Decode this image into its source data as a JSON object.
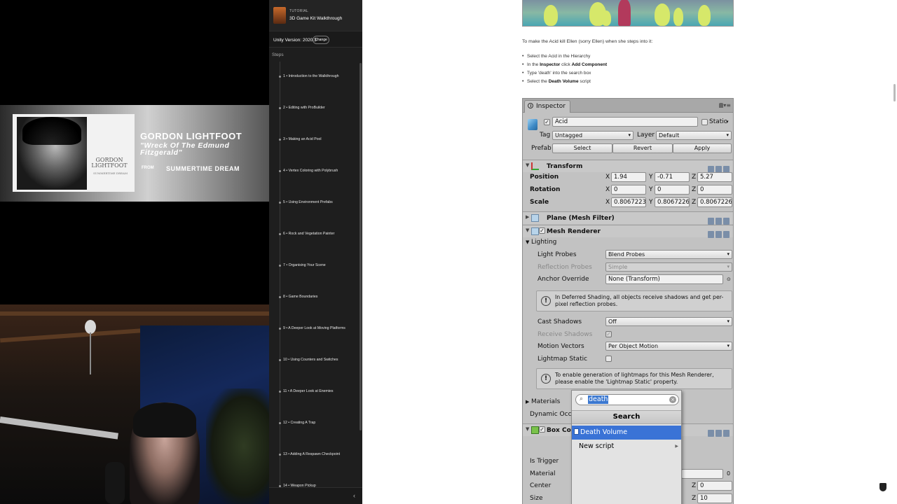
{
  "overlay": {
    "now_playing": {
      "artist": "GORDON LIGHTFOOT",
      "song": "\"Wreck Of The Edmund Fitzgerald\"",
      "from_label": "FROM",
      "album": "SUMMERTIME DREAM",
      "album_cover_text": "GORDON LIGHTFOOT",
      "album_cover_subtext": "SUMMERTIME DREAM"
    }
  },
  "sidebar": {
    "kicker": "TUTORIAL",
    "title": "3D Game Kit Walkthrough",
    "version_label": "Unity Version: 2020.3",
    "change_button": "Change",
    "steps_label": "Steps",
    "steps": [
      {
        "label": "1 • Introduction to the Walkthrough"
      },
      {
        "label": "2 • Editing with ProBuilder"
      },
      {
        "label": "3 • Making an Acid Pool"
      },
      {
        "label": "4 • Vertex Coloring with Polybrush"
      },
      {
        "label": "5 • Using Environment Prefabs"
      },
      {
        "label": "6 • Rock and Vegetation Painter"
      },
      {
        "label": "7 • Organising Your Scene"
      },
      {
        "label": "8 • Game Boundaries"
      },
      {
        "label": "9 • A Deeper Look at Moving Platforms"
      },
      {
        "label": "10 • Using Counters and Switches"
      },
      {
        "label": "11 • A Deeper Look at Enemies"
      },
      {
        "label": "12 • Creating A Trap"
      },
      {
        "label": "13 • Adding A Respawn Checkpoint"
      },
      {
        "label": "14 • Weapon Pickup"
      }
    ],
    "collapse_icon": "‹"
  },
  "article": {
    "intro": "To make the Acid kill Ellen (sorry Ellen) when she steps into it:",
    "bullets": [
      {
        "pre": "Select the Acid in the Hierarchy",
        "bold": "",
        "post": ""
      },
      {
        "pre": "In the ",
        "bold": "Inspector",
        "post": " click ",
        "bold2": "Add Component"
      },
      {
        "pre": "Type 'death' into the search box",
        "bold": "",
        "post": ""
      },
      {
        "pre": "Select the ",
        "bold": "Death Volume",
        "post": " script"
      }
    ]
  },
  "inspector": {
    "tab": "Inspector",
    "object_name": "Acid",
    "static_label": "Static",
    "tag_label": "Tag",
    "tag_value": "Untagged",
    "layer_label": "Layer",
    "layer_value": "Default",
    "prefab_label": "Prefab",
    "prefab_buttons": [
      "Select",
      "Revert",
      "Apply"
    ],
    "transform": {
      "title": "Transform",
      "position_label": "Position",
      "rotation_label": "Rotation",
      "scale_label": "Scale",
      "position": [
        "1.94",
        "-0.71",
        "5.27"
      ],
      "rotation": [
        "0",
        "0",
        "0"
      ],
      "scale": [
        "0.8067223",
        "0.8067226",
        "0.8067226"
      ],
      "axes": [
        "X",
        "Y",
        "Z"
      ]
    },
    "mesh_filter_title": "Plane (Mesh Filter)",
    "mesh_renderer": {
      "title": "Mesh Renderer",
      "lighting_label": "Lighting",
      "light_probes_label": "Light Probes",
      "light_probes_value": "Blend Probes",
      "reflection_probes_label": "Reflection Probes",
      "reflection_probes_value": "Simple",
      "anchor_override_label": "Anchor Override",
      "anchor_override_value": "None (Transform)",
      "help_deferred": "In Deferred Shading, all objects receive shadows and get per-pixel reflection probes.",
      "cast_shadows_label": "Cast Shadows",
      "cast_shadows_value": "Off",
      "receive_shadows_label": "Receive Shadows",
      "motion_vectors_label": "Motion Vectors",
      "motion_vectors_value": "Per Object Motion",
      "lightmap_static_label": "Lightmap Static",
      "help_lightmap": "To enable generation of lightmaps for this Mesh Renderer, please enable the 'Lightmap Static' property.",
      "materials_label": "Materials",
      "dynamic_occluded_label": "Dynamic Occlu"
    },
    "box_collider": {
      "title": "Box Coll",
      "is_trigger_label": "Is Trigger",
      "material_label": "Material",
      "center_label": "Center",
      "size_label": "Size",
      "center_z": "0",
      "size_z": "10"
    },
    "zero": "0",
    "z_label": "Z"
  },
  "add_component_popup": {
    "search_value": "death",
    "header": "Search",
    "items": [
      "Death Volume",
      "New script"
    ]
  },
  "colors": {
    "selection_blue": "#3a73d6",
    "sidebar_bg": "#1e1e1e",
    "inspector_bg": "#c2c2c2"
  }
}
